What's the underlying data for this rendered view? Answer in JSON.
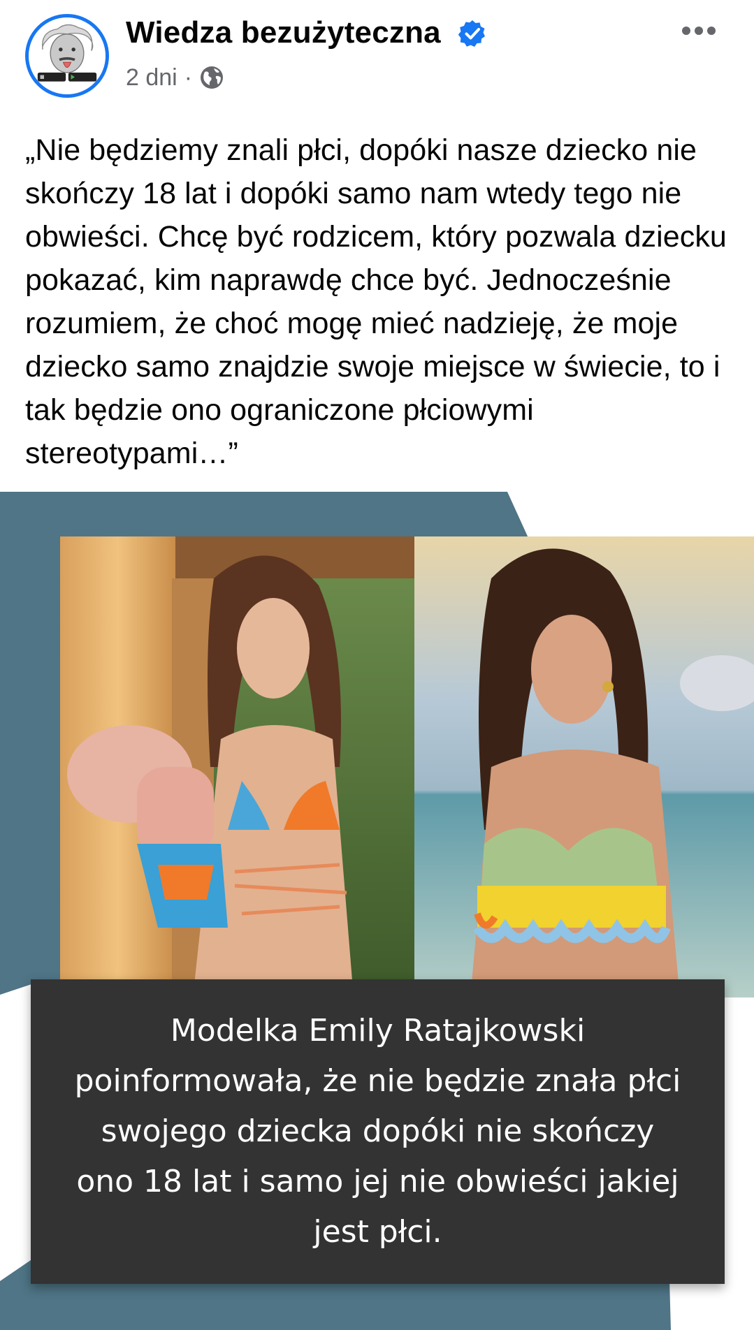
{
  "post": {
    "page_name": "Wiedza bezużyteczna",
    "verified_icon": "verified-badge-icon",
    "time": "2 dni",
    "separator": "·",
    "audience_icon": "globe-icon",
    "more_icon": "more-options-icon",
    "text": "„Nie będziemy znali płci, dopóki nasze dziecko nie skończy 18 lat i dopóki samo nam wtedy tego nie obwieści. Chcę być rodzicem, który pozwala dziecku pokazać, kim naprawdę chce być. Jednocześnie rozumiem, że choć mogę mieć nadzieję, że moje dziecko samo znajdzie swoje miejsce w świecie, to i tak będzie ono ograniczone płciowymi stereotypami…”"
  },
  "image": {
    "caption": "Modelka Emily Ratajkowski poinformowała, że nie będzie znała płci swojego dziecka dopóki nie skończy ono 18 lat i samo jej nie obwieści jakiej jest płci."
  },
  "colors": {
    "brand_blue": "#1877f2",
    "meta_gray": "#65676b",
    "image_bg": "#4f7586",
    "caption_bg": "#333333"
  }
}
